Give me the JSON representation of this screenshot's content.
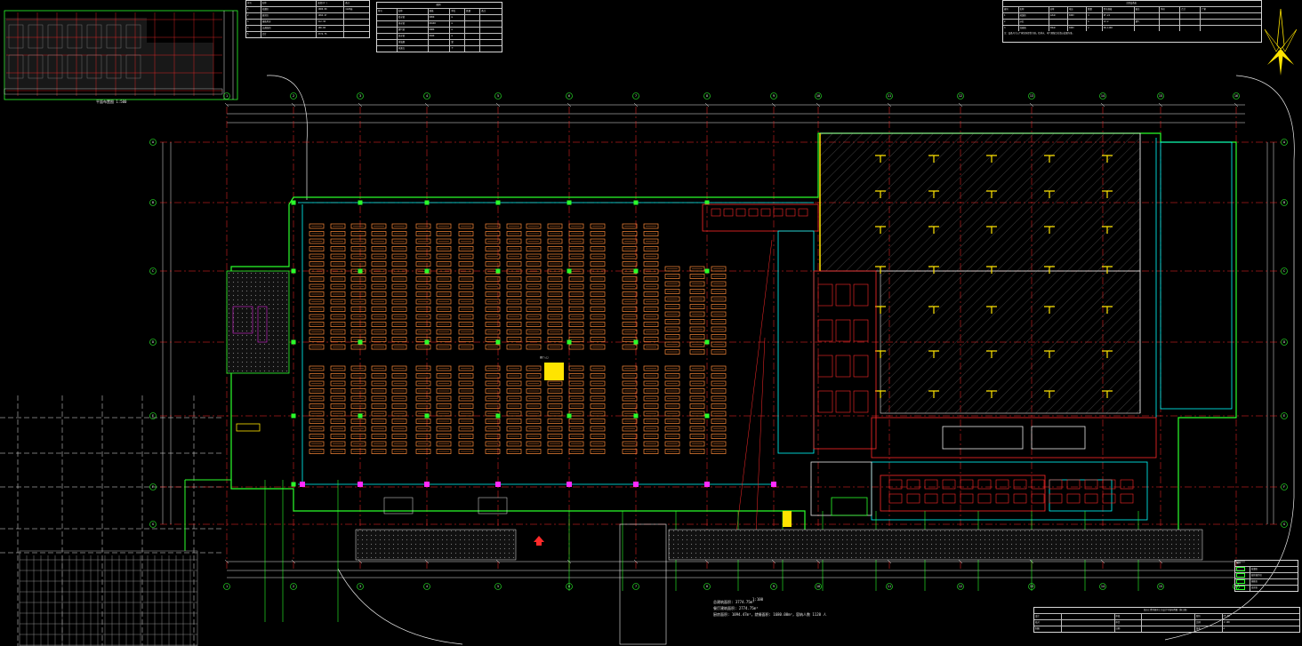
{
  "colors": {
    "background": "#000000",
    "wall": "#2bff2b",
    "axis": "#ff2a2a",
    "dimension": "#e8e8e8",
    "furniture": "#ff8c3a",
    "hatch": "#8a8a8a",
    "equipment": "#ff2a2a",
    "pipe": "#00ffff",
    "column": "#ffe400",
    "door": "#ff2aff"
  },
  "icons": {
    "north_arrow": "compass-star-icon",
    "entrance_marker": "red-arrow-icon"
  },
  "drawing": {
    "grid_axes": [
      "1",
      "2",
      "3",
      "4",
      "5",
      "6",
      "7",
      "8",
      "9",
      "10",
      "11",
      "12",
      "13",
      "14",
      "15",
      "16",
      "17",
      "18",
      "19",
      "20"
    ],
    "grid_rows": [
      "A",
      "B",
      "C",
      "D",
      "E",
      "F",
      "G",
      "H"
    ],
    "thumbnail_caption": "平面布置图 1:500",
    "center_sign": "餐厅入口",
    "area_summary": [
      "总建筑面积: 3774.75m²",
      "餐厅建筑面积: 2774.75m²",
      "厨房面积: 1094.47m²，就餐面积: 1680.00m²，容纳人数 1120 人"
    ],
    "scale_note": "1:100"
  },
  "table_top_left": {
    "header": [
      "序号",
      "名称",
      "面积(m²)",
      "备注"
    ],
    "rows": [
      [
        "1",
        "就餐区",
        "1680.00",
        "1120座"
      ],
      [
        "2",
        "厨房区",
        "1094.47",
        ""
      ],
      [
        "3",
        "辅助用房",
        "512.30",
        ""
      ],
      [
        "4",
        "交通面积",
        "488.00",
        ""
      ],
      [
        "5",
        "合计",
        "3774.75",
        ""
      ]
    ]
  },
  "table_legend": {
    "title": "图例",
    "header": [
      "符号",
      "名称",
      "规格",
      "单位",
      "数量",
      "备注"
    ],
    "rows": [
      [
        "",
        "给水管",
        "DN50",
        "m",
        "",
        ""
      ],
      [
        "",
        "排水管",
        "DN100",
        "m",
        "",
        ""
      ],
      [
        "",
        "燃气管",
        "DN80",
        "m",
        "",
        ""
      ],
      [
        "",
        "热水管",
        "DN40",
        "m",
        "",
        ""
      ],
      [
        "",
        "排油烟",
        "",
        "套",
        "",
        ""
      ],
      [
        "",
        "电源点",
        "",
        "个",
        "",
        ""
      ]
    ]
  },
  "table_equipment": {
    "title": "主要设备表",
    "header": [
      "编号",
      "名称",
      "功率",
      "电压",
      "数量",
      "型号规格",
      "备注",
      "单价",
      "合计",
      "厂家"
    ],
    "rows": [
      [
        "1",
        "蒸饭柜",
        "12kW",
        "380V",
        "4",
        "ZF-24",
        "",
        "",
        "",
        ""
      ],
      [
        "2",
        "炒灶",
        "",
        "",
        "6",
        "CZ-2",
        "燃气",
        "",
        "",
        ""
      ],
      [
        "3",
        "洗碗机",
        "30kW",
        "380V",
        "2",
        "XW-1200",
        "",
        "",
        "",
        ""
      ]
    ],
    "note": "注：设备尺寸以厂家实际提供为准，给排水、电气预留点位请以此图为准。"
  },
  "table_side_legend": {
    "title": "图例",
    "rows": [
      "就餐区",
      "厨房操作区",
      "辅助区",
      "库房区"
    ]
  },
  "title_block": {
    "title": "某员工食堂厨房工艺设计平面布置图（施工图）",
    "rows": [
      [
        "设计",
        "",
        "审核",
        "",
        "图号",
        "CF-01"
      ],
      [
        "校对",
        "",
        "审定",
        "",
        "比例",
        "1:100"
      ],
      [
        "制图",
        "",
        "日期",
        "",
        "版本",
        "A"
      ]
    ]
  }
}
